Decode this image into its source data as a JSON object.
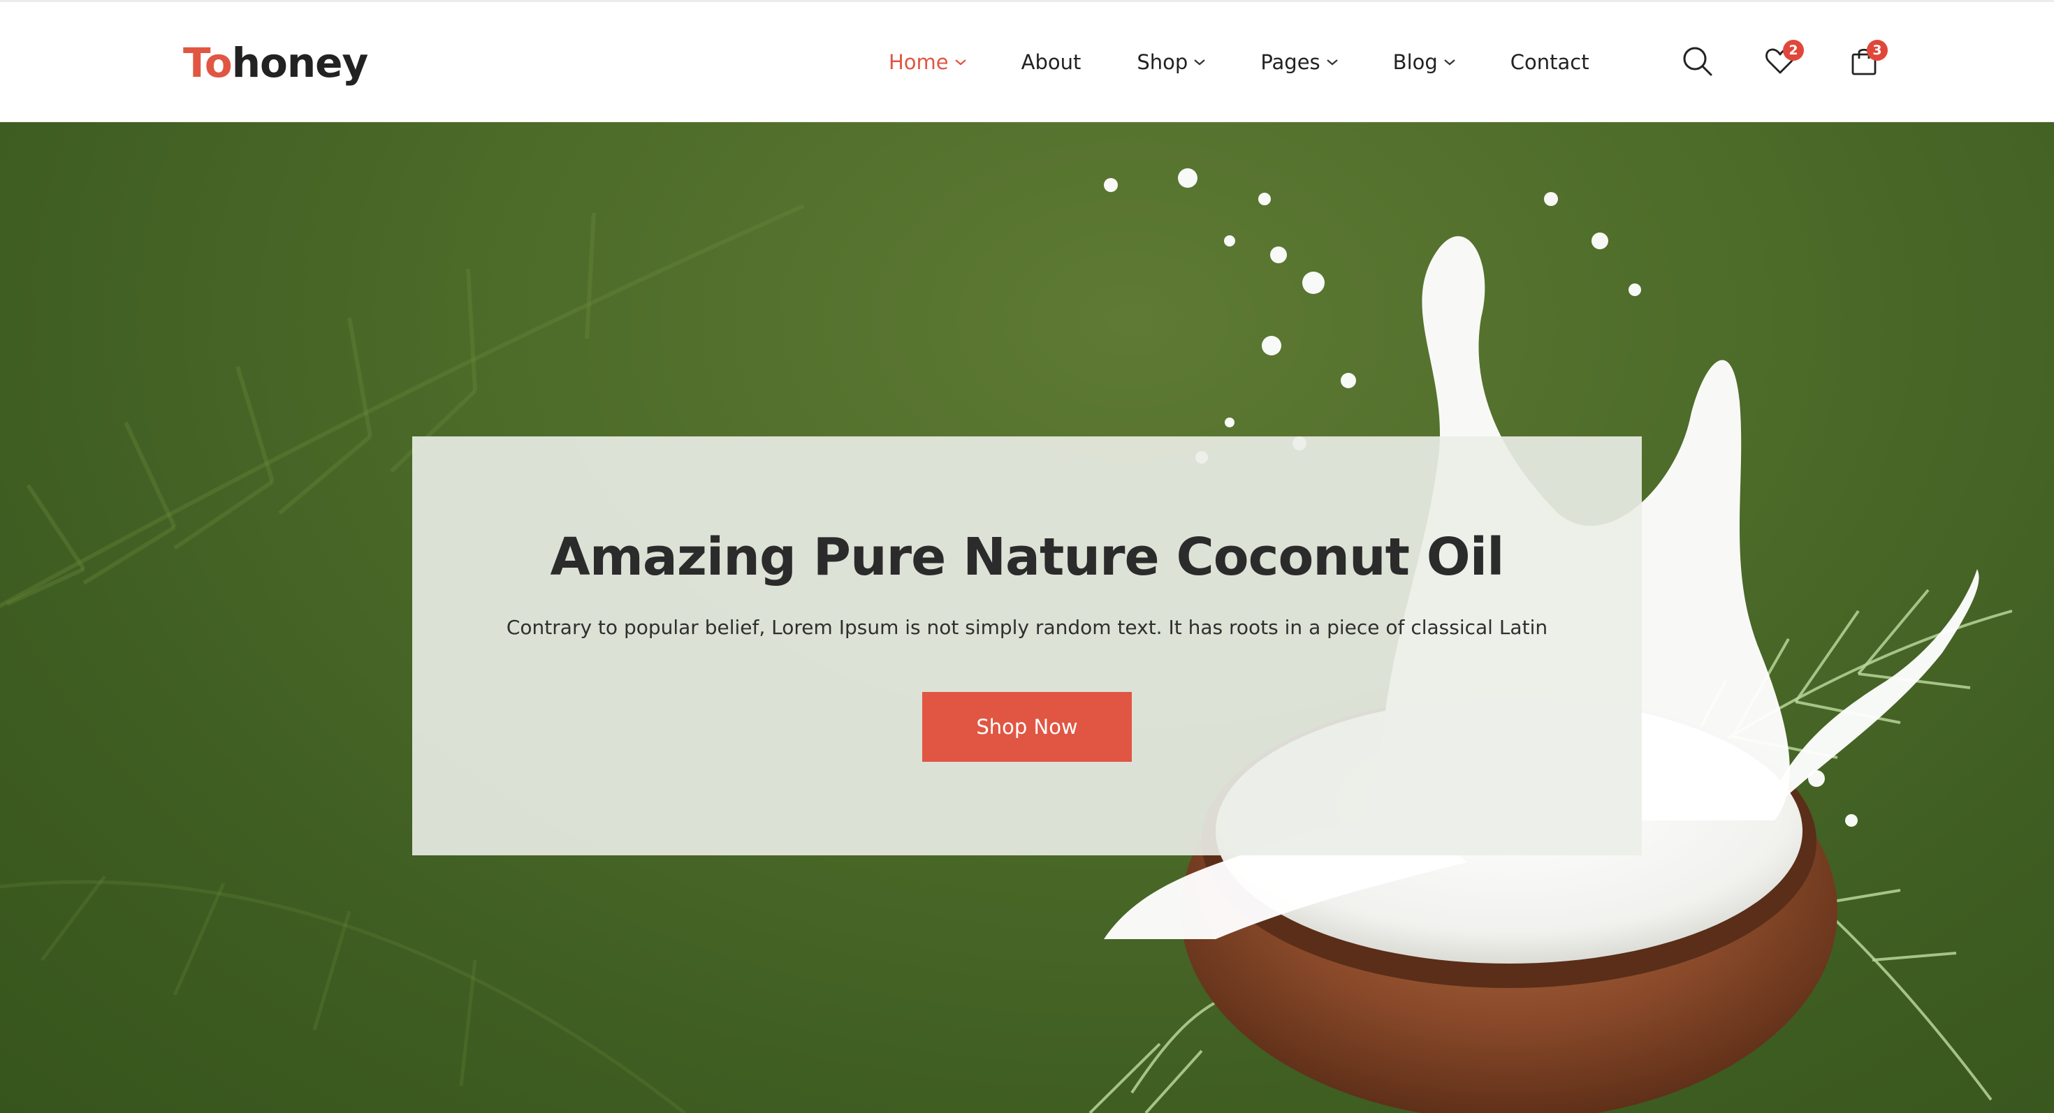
{
  "header": {
    "logo": {
      "part1": "To",
      "part2": "honey"
    },
    "nav": [
      {
        "label": "Home",
        "dropdown": true,
        "active": true
      },
      {
        "label": "About",
        "dropdown": false,
        "active": false
      },
      {
        "label": "Shop",
        "dropdown": true,
        "active": false
      },
      {
        "label": "Pages",
        "dropdown": true,
        "active": false
      },
      {
        "label": "Blog",
        "dropdown": true,
        "active": false
      },
      {
        "label": "Contact",
        "dropdown": false,
        "active": false
      }
    ],
    "icons": {
      "search": "search-icon",
      "wishlist": "heart-icon",
      "cart": "shopping-bag-icon"
    },
    "wishlist_count": "2",
    "cart_count": "3"
  },
  "hero": {
    "title": "Amazing Pure Nature Coconut Oil",
    "description": "Contrary to popular belief, Lorem Ipsum is not simply random text. It has roots in a piece of classical Latin",
    "cta_label": "Shop Now"
  },
  "colors": {
    "accent": "#e05643",
    "badge": "#e0473a",
    "hero_green": "#4f6d2a",
    "text_dark": "#222222"
  }
}
